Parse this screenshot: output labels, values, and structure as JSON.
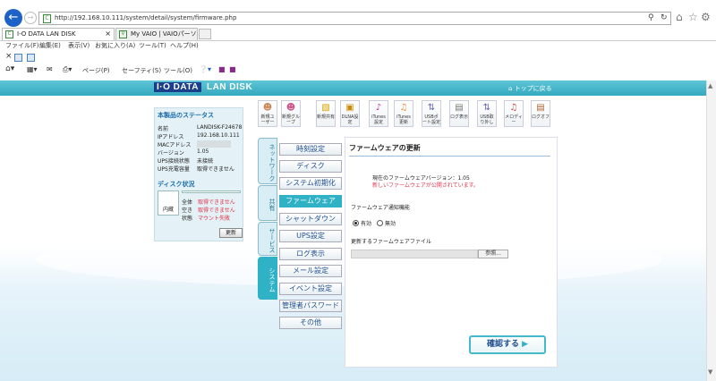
{
  "browser": {
    "url": "http://192.168.10.111/system/detail/system/firmware.php",
    "url_icons": [
      "search-icon",
      "refresh-icon"
    ],
    "tabs": [
      {
        "label": "I-O DATA LAN DISK",
        "close": "×"
      },
      {
        "label": "My VAIO | VAIOパーソナルコンピュ..."
      }
    ],
    "menu": [
      "ファイル(F)",
      "編集(E)",
      "表示(V)",
      "お気に入り(A)",
      "ツール(T)",
      "ヘルプ(H)"
    ],
    "favbar_close": "×",
    "cmd": [
      "ページ(P)",
      "セーフティ(S)",
      "ツール(O)"
    ]
  },
  "header": {
    "logo_brand": "I·O DATA",
    "logo_product": "LAN DISK",
    "top_link": "トップに戻る"
  },
  "status": {
    "title": "本製品のステータス",
    "rows": [
      {
        "label": "名前",
        "value": "LANDISK-F24678"
      },
      {
        "label": "IPアドレス",
        "value": "192.168.10.111"
      },
      {
        "label": "MACアドレス",
        "value": ""
      },
      {
        "label": "バージョン",
        "value": "1.05"
      },
      {
        "label": "UPS接続状態",
        "value": "未接続"
      },
      {
        "label": "UPS充電容量",
        "value": "取得できません"
      }
    ],
    "disk_title": "ディスク状況",
    "disk_label": "内蔵",
    "disk_rows": [
      {
        "label": "全体",
        "value": "取得できません"
      },
      {
        "label": "空き",
        "value": "取得できません"
      },
      {
        "label": "状態",
        "value": "マウント失敗"
      }
    ],
    "refresh": "更新"
  },
  "toolbar": [
    {
      "label": "新規ユーザー",
      "icon": "users-icon"
    },
    {
      "label": "新規グループ",
      "icon": "group-icon"
    },
    {
      "label": "新規共有",
      "icon": "folder-icon"
    },
    {
      "label": "DLNA設定",
      "icon": "media-icon"
    },
    {
      "label": "iTunes設定",
      "icon": "music-icon"
    },
    {
      "label": "iTunes更新",
      "icon": "music-update-icon"
    },
    {
      "label": "USBポート設定",
      "icon": "usb-icon"
    },
    {
      "label": "ログ表示",
      "icon": "log-icon"
    },
    {
      "label": "USB取り外し",
      "icon": "usb-remove-icon"
    },
    {
      "label": "メロディー",
      "icon": "melody-icon"
    },
    {
      "label": "ログオフ",
      "icon": "logoff-icon"
    }
  ],
  "side_tabs": [
    "ネットワーク",
    "共有",
    "サービス",
    "システム"
  ],
  "nav": [
    "時刻設定",
    "ディスク",
    "システム初期化",
    "ファームウェア",
    "シャットダウン",
    "UPS設定",
    "ログ表示",
    "メール設定",
    "イベント設定",
    "管理者パスワード",
    "その他"
  ],
  "content": {
    "title": "ファームウェアの更新",
    "current_version": "現在のファームウェアバージョン：1.05",
    "new_available": "新しいファームウェアが公開されています。",
    "notify_label": "ファームウェア通知機能",
    "radio_on": "有効",
    "radio_off": "無効",
    "file_label": "更新するファームウェアファイル",
    "browse": "参照...",
    "confirm": "確認する"
  },
  "colors": {
    "accent": "#2fb1c6",
    "header": "#45b8c9",
    "alert": "#e0334a",
    "link": "#1f4f8f"
  }
}
